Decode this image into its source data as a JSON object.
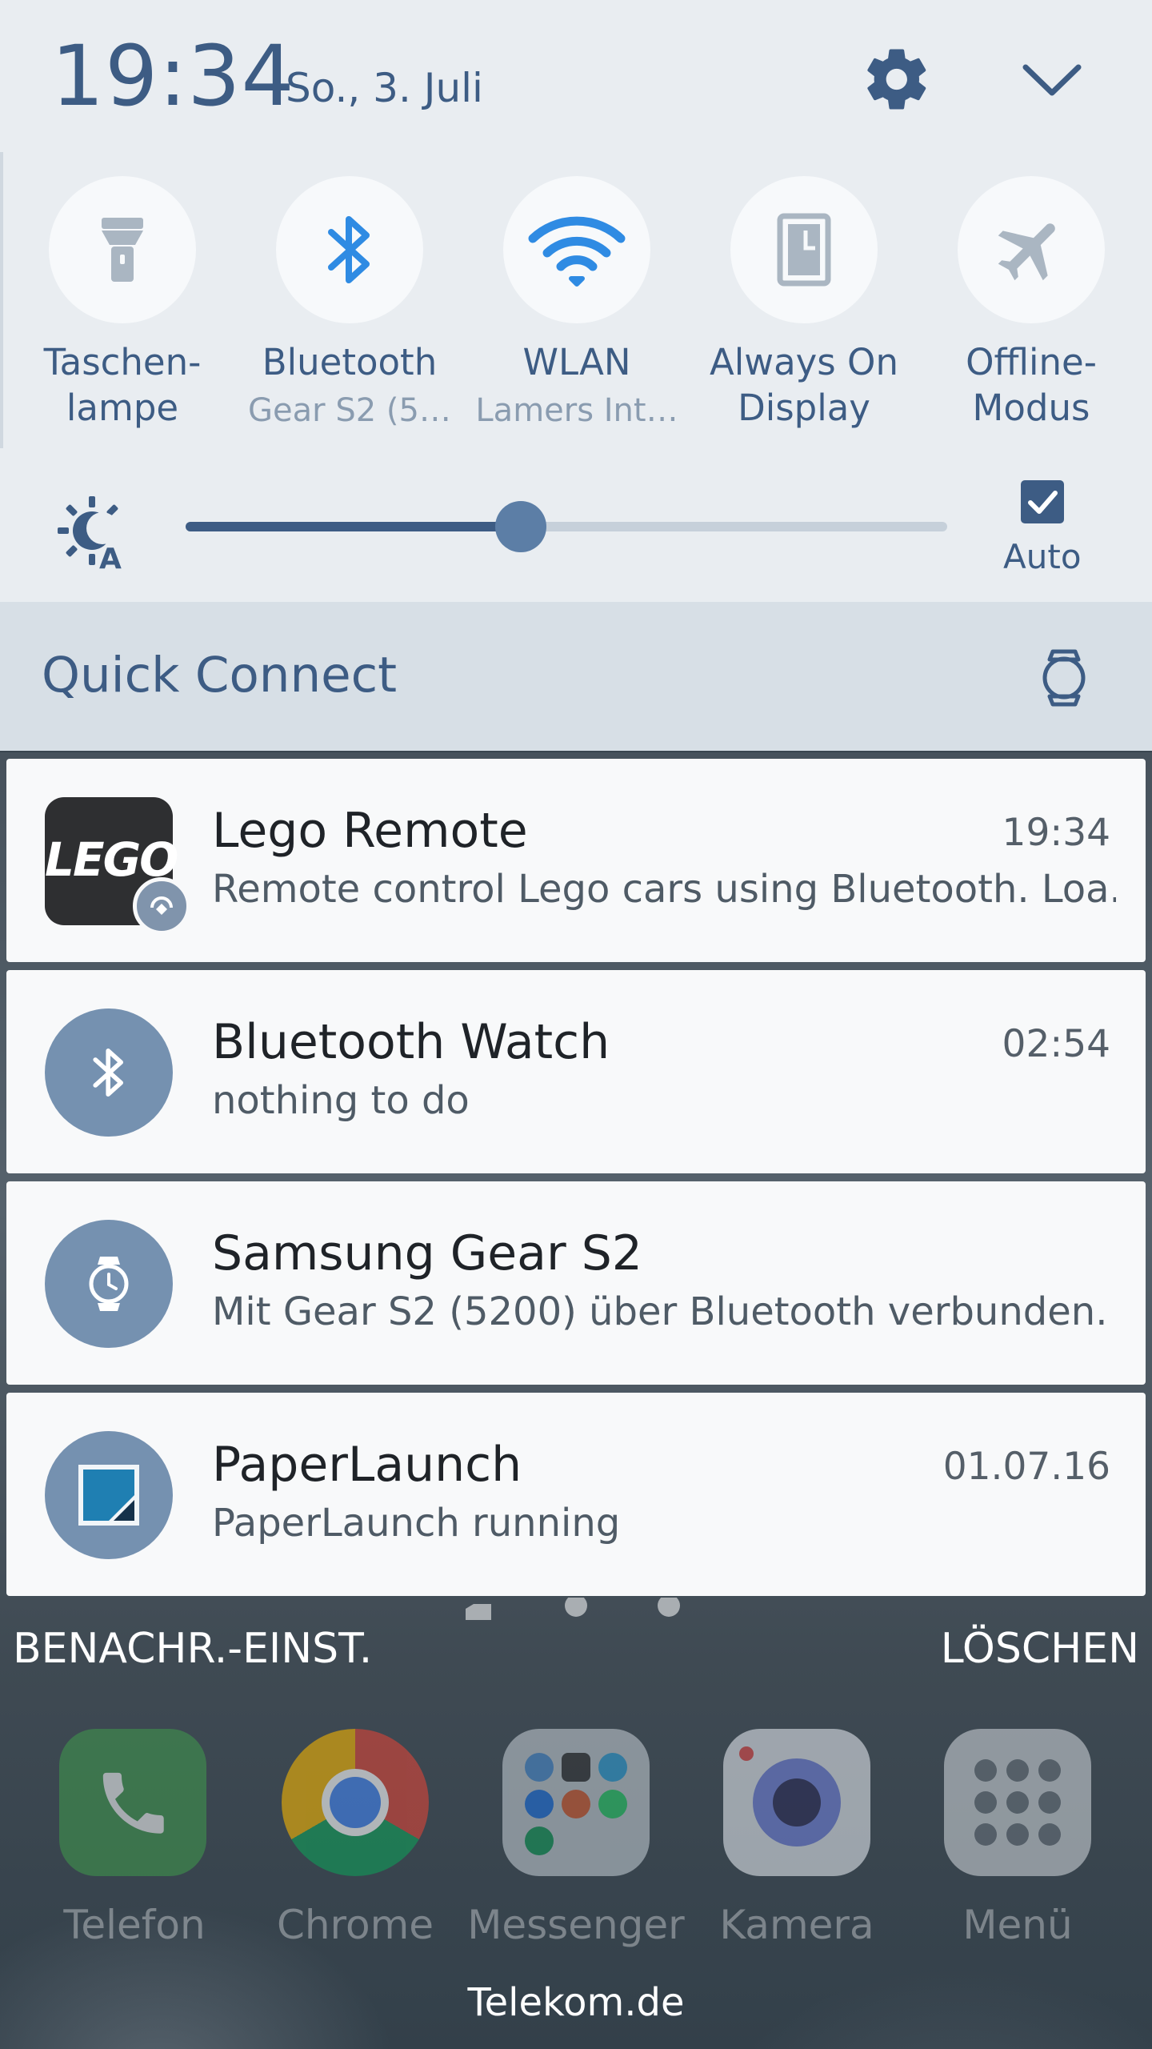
{
  "status": {
    "time": "19:34",
    "date": "So., 3. Juli"
  },
  "icons": {
    "settings": "gear-icon",
    "collapse": "chevron-down-icon"
  },
  "quick_tiles": [
    {
      "label": "Taschen-\nlampe",
      "line1": "Taschen-",
      "line2": "lampe",
      "sub": "",
      "icon": "flashlight-icon",
      "active": false
    },
    {
      "label": "Bluetooth",
      "line1": "Bluetooth",
      "line2": "",
      "sub": "Gear S2 (5…",
      "icon": "bluetooth-icon",
      "active": true
    },
    {
      "label": "WLAN",
      "line1": "WLAN",
      "line2": "",
      "sub": "Lamers Int…",
      "icon": "wifi-icon",
      "active": true
    },
    {
      "label": "Always On Display",
      "line1": "Always On",
      "line2": "Display",
      "sub": "",
      "icon": "always-on-display-icon",
      "active": false
    },
    {
      "label": "Offline-Modus",
      "line1": "Offline-",
      "line2": "Modus",
      "sub": "",
      "icon": "airplane-icon",
      "active": false
    }
  ],
  "brightness": {
    "level": 0.44,
    "auto_label": "Auto",
    "auto_checked": true
  },
  "quick_connect": {
    "title": "Quick Connect"
  },
  "notifications": [
    {
      "app": "Lego Remote",
      "time": "19:34",
      "text": "Remote control Lego cars using Bluetooth. Loa..",
      "logo_text": "LEGO"
    },
    {
      "app": "Bluetooth Watch",
      "time": "02:54",
      "text": "nothing to do"
    },
    {
      "app": "Samsung Gear S2",
      "time": "",
      "text": "Mit Gear S2 (5200) über Bluetooth verbunden."
    },
    {
      "app": "PaperLaunch",
      "time": "01.07.16",
      "text": "PaperLaunch running"
    }
  ],
  "actions": {
    "settings": "BENACHR.-EINST.",
    "clear": "LÖSCHEN"
  },
  "dock": [
    {
      "label": "Telefon",
      "icon": "phone-icon"
    },
    {
      "label": "Chrome",
      "icon": "chrome-icon"
    },
    {
      "label": "Messenger",
      "icon": "messenger-folder-icon"
    },
    {
      "label": "Kamera",
      "icon": "camera-icon"
    },
    {
      "label": "Menü",
      "icon": "apps-grid-icon"
    }
  ],
  "carrier": "Telekom.de",
  "colors": {
    "accent": "#3d5c84",
    "panel": "#e9edf1",
    "bt_blue": "#2f8be3"
  }
}
